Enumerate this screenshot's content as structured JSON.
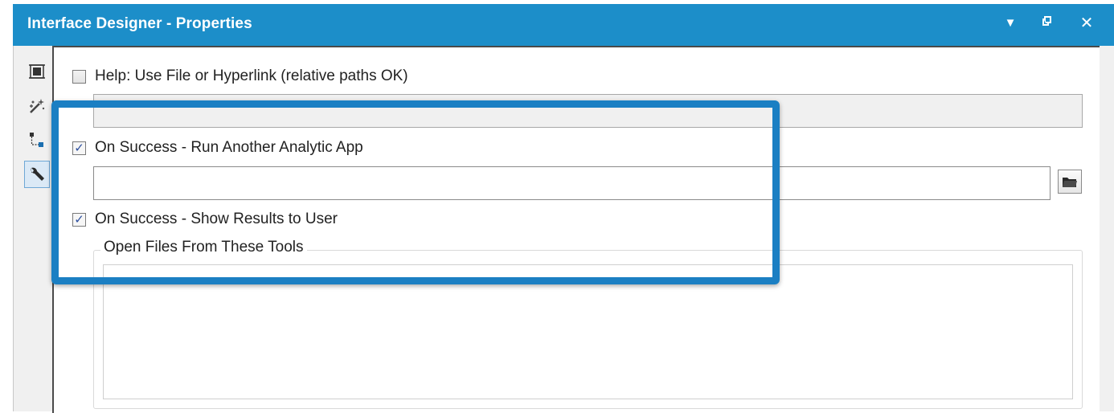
{
  "window": {
    "title": "Interface Designer - Properties",
    "controls": {
      "dropdown_icon": "▼",
      "float_icon": "⧉",
      "close_icon": "✕"
    }
  },
  "toolbar": {
    "items": [
      {
        "name": "layout-icon",
        "active": false
      },
      {
        "name": "magic-wand-icon",
        "active": false
      },
      {
        "name": "tree-icon",
        "active": false
      },
      {
        "name": "wrench-icon",
        "active": true
      }
    ]
  },
  "properties": {
    "help": {
      "label": "Help: Use File or Hyperlink (relative paths OK)",
      "checked": false,
      "value": ""
    },
    "run_app": {
      "label": "On Success - Run Another Analytic App",
      "checked": true,
      "value": ""
    },
    "show_results": {
      "label": "On Success - Show Results to User",
      "checked": true
    },
    "open_files_group": {
      "label": "Open Files From These Tools",
      "items": []
    }
  },
  "colors": {
    "title_bar": "#1c8ec9",
    "highlight": "#1b7fc3"
  }
}
